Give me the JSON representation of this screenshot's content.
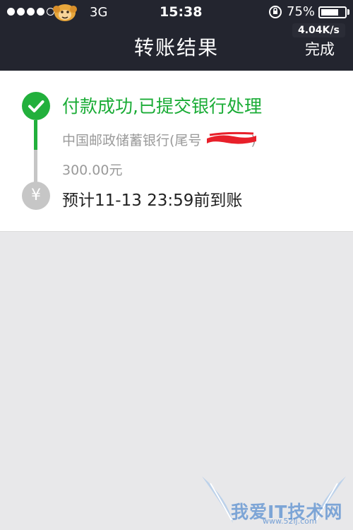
{
  "status_bar": {
    "network": "3G",
    "time": "15:38",
    "battery": "75%",
    "battery_level": 0.75,
    "speed": "4.04K/s"
  },
  "header": {
    "title": "转账结果",
    "done_label": "完成"
  },
  "result": {
    "status": "付款成功,已提交银行处理",
    "bank": "中国邮政储蓄银行(尾号",
    "bank_close": ")",
    "amount": "300.00元",
    "eta": "预计11-13 23:59前到账"
  },
  "icons": {
    "success": "check-circle-icon",
    "pending": "yen-circle-icon",
    "rotation": "rotation-lock-icon"
  },
  "colors": {
    "header_bg": "#23252f",
    "success_green": "#1aac36",
    "inactive_gray": "#c6c6c6",
    "background": "#e8e8ea"
  },
  "watermark": {
    "text": "我爱IT技术网",
    "url": "www.52ij.com"
  }
}
